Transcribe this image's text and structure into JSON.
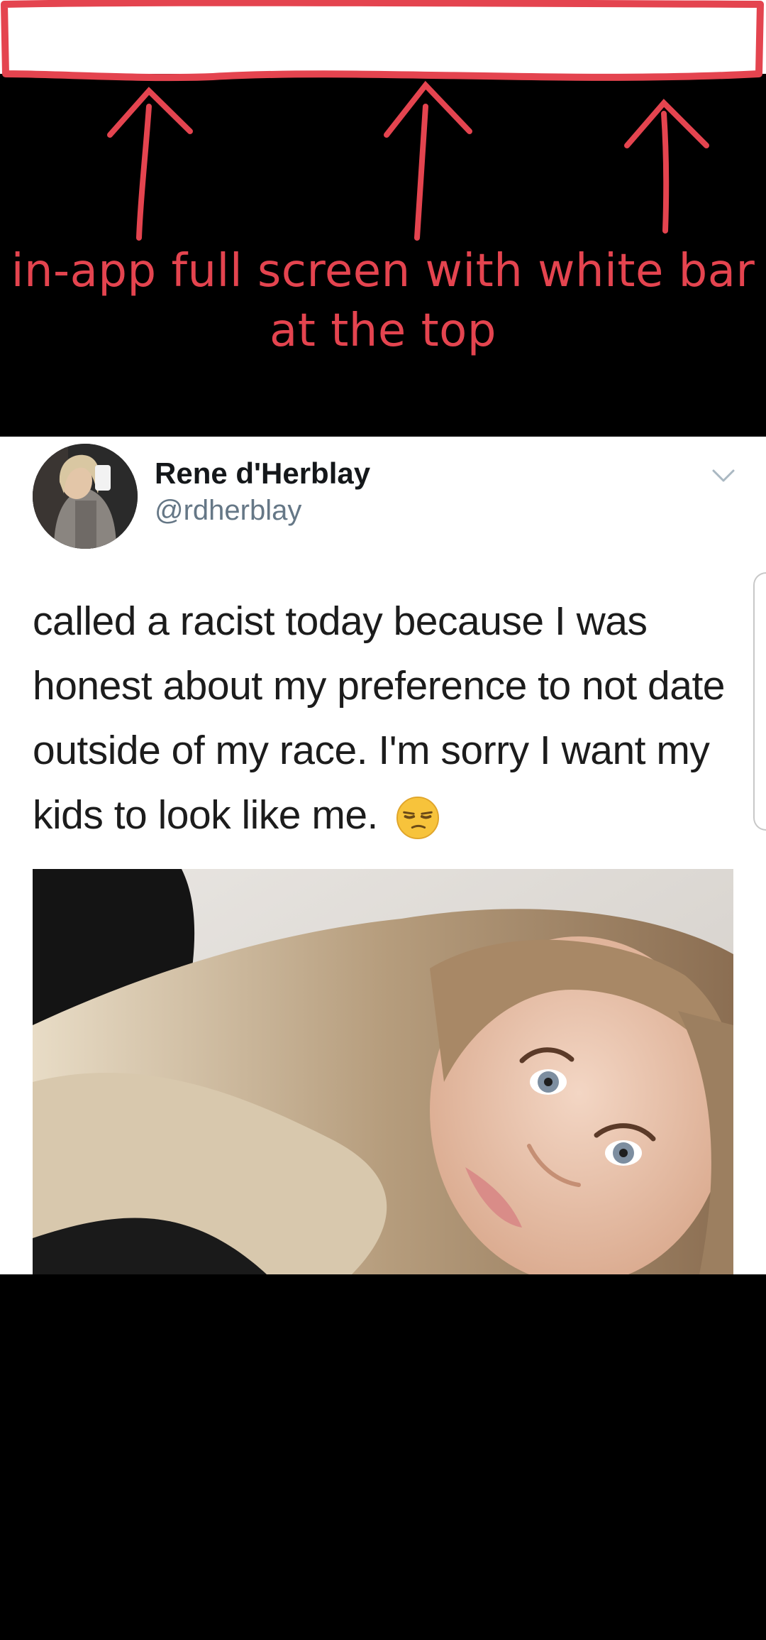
{
  "annotation": {
    "text_line_1": "in-app full screen with white bar",
    "text_line_2": "at the top",
    "color": "#e4444f"
  },
  "tweet": {
    "author_name": "Rene d'Herblay",
    "author_handle": "@rdherblay",
    "text": "called a racist today because I was honest about my preference to not date outside of my race. I'm sorry I want my kids to look like me.",
    "emoji": "unamused-face-icon",
    "menu_icon": "chevron-down-icon",
    "text_color": "#1c1c1c",
    "handle_color": "#657786"
  }
}
